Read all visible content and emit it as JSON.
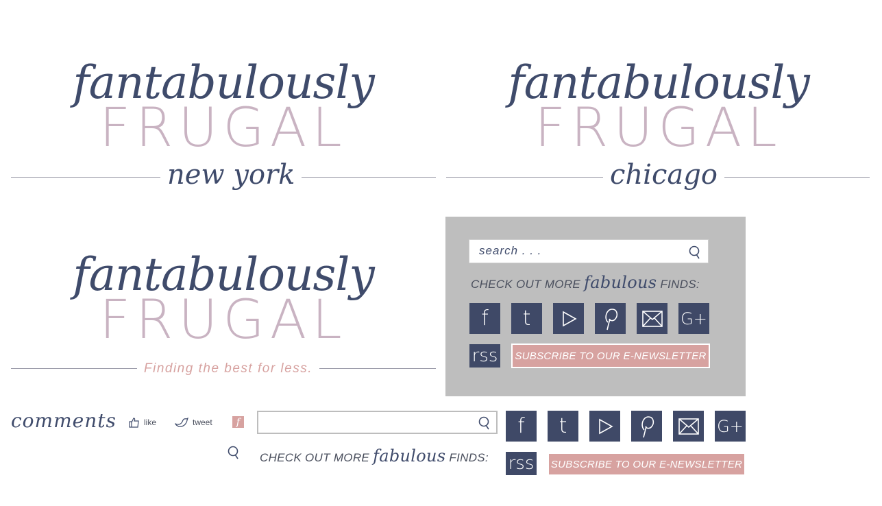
{
  "logos": [
    {
      "script": "fantabulously",
      "word": "FRUGAL",
      "tagline": "new york"
    },
    {
      "script": "fantabulously",
      "word": "FRUGAL",
      "tagline": "chicago"
    },
    {
      "script": "fantabulously",
      "word": "FRUGAL",
      "tagline": "Finding the best for less."
    }
  ],
  "sidebar": {
    "search_placeholder": "search . . .",
    "cta_prefix": "CHECK OUT MORE",
    "cta_script": "fabulous",
    "cta_suffix": "FINDS:",
    "icons": [
      "f",
      "t",
      "▷",
      "p",
      "✉",
      "G+"
    ],
    "rss_label": "rss",
    "subscribe_label": "SUBSCRIBE TO OUR E-NEWSLETTER"
  },
  "bottom": {
    "comments_label": "comments",
    "like_label": "like",
    "tweet_label": "tweet",
    "cta_prefix": "CHECK OUT MORE",
    "cta_script": "fabulous",
    "cta_suffix": "FINDS:",
    "icons": [
      "f",
      "t",
      "▷",
      "p",
      "✉",
      "G+"
    ],
    "rss_label": "rss",
    "subscribe_label": "SUBSCRIBE TO OUR E-NEWSLETTER"
  },
  "colors": {
    "navy": "#3f4967",
    "mauve": "#c9b3c2",
    "salmon": "#d7a2a0",
    "panel": "#bebebe"
  }
}
